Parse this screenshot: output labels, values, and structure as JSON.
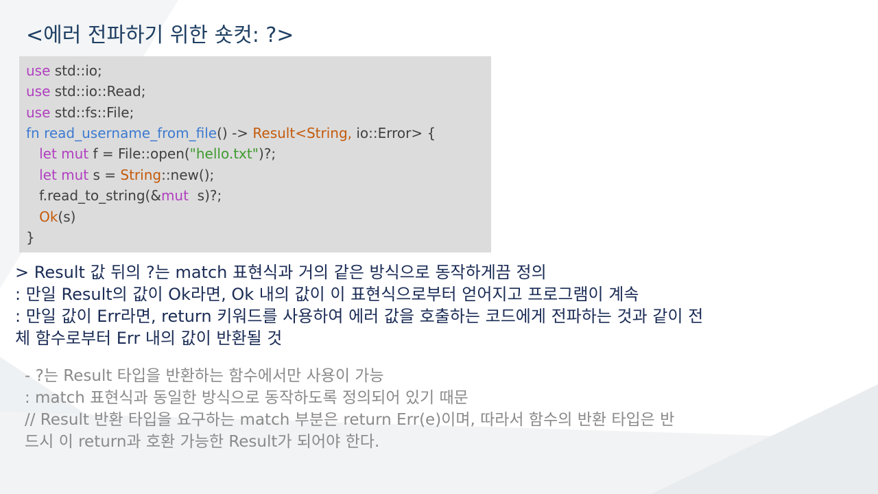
{
  "slide": {
    "title": "<에러 전파하기 위한 숏컷: ?>"
  },
  "code": {
    "l1": [
      "use",
      " std::io;"
    ],
    "l2": [
      "use",
      " std::io::Read;"
    ],
    "l3": [
      "use",
      " std::fs::File;"
    ],
    "l4": [
      "fn",
      " ",
      "read_username_from_file",
      "() -> ",
      "Result<String,",
      " io::Error> {"
    ],
    "l5": [
      "   ",
      "let mut",
      " f = File::open(",
      "\"hello.txt\"",
      ")?;"
    ],
    "l6": [
      "   ",
      "let mut",
      " s = ",
      "String",
      "::new();"
    ],
    "l7": [
      "   f.read_to_string(&",
      "mut",
      "  s)?;"
    ],
    "l8": [
      "   ",
      "Ok",
      "(s)"
    ],
    "l9": "}"
  },
  "description": {
    "line1": "> Result 값 뒤의 ?는 match 표현식과 거의 같은 방식으로 동작하게끔 정의",
    "line2": ": 만일 Result의 값이 Ok라면, Ok 내의 값이 이 표현식으로부터 얻어지고 프로그램이 계속",
    "line3": ": 만일 값이 Err라면, return 키워드를 사용하여 에러 값을 호출하는 코드에게 전파하는 것과 같이 전",
    "line4": "체 함수로부터 Err 내의 값이 반환될 것"
  },
  "note": {
    "line1": "- ?는 Result 타입을 반환하는 함수에서만 사용이 가능",
    "line2": " : match 표현식과 동일한 방식으로 동작하도록 정의되어 있기 때문",
    "line3": "// Result 반환 타입을 요구하는 match 부분은 return Err(e)이며, 따라서 함수의 반환 타입은 반",
    "line4": " 드시 이 return과 호환 가능한 Result가 되어야 한다."
  },
  "colors": {
    "title": "#1f3f63",
    "code_bg": "#dcdcdc",
    "keyword": "#b03fc0",
    "function_name": "#3c7ad0",
    "type": "#c45a0a",
    "string": "#3e9a2e",
    "description": "#1a2b55",
    "note": "#8a8a8a"
  }
}
